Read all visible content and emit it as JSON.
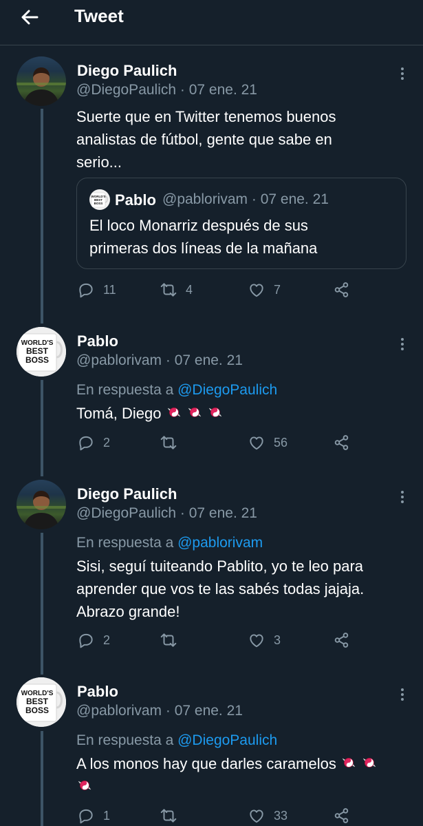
{
  "header": {
    "title": "Tweet",
    "back_icon": "arrow-left-icon"
  },
  "colors": {
    "background": "#15202b",
    "text": "#ffffff",
    "muted": "#8899a6",
    "link": "#1d9bf0",
    "border": "#38444d"
  },
  "tweets": [
    {
      "name": "Diego Paulich",
      "meta": "@DiegoPaulich · 07 ene. 21",
      "text_lines": [
        "Suerte que en Twitter tenemos buenos",
        "analistas de fútbol, gente que sabe en",
        "serio..."
      ],
      "quote": {
        "name": "Pablo",
        "meta": "@pablorivam · 07 ene. 21",
        "text_lines": [
          "El loco Monarriz después de sus",
          "primeras dos líneas de la mañana"
        ]
      },
      "replies": "11",
      "retweets": "4",
      "likes": "7"
    },
    {
      "name": "Pablo",
      "meta": "@pablorivam · 07 ene. 21",
      "reply_prefix": "En respuesta a",
      "reply_to": "@DiegoPaulich",
      "text_lines": [
        "Tomá, Diego"
      ],
      "candies": 3,
      "replies": "2",
      "retweets": "",
      "likes": "56"
    },
    {
      "name": "Diego Paulich",
      "meta": "@DiegoPaulich · 07 ene. 21",
      "reply_prefix": "En respuesta a",
      "reply_to": "@pablorivam",
      "text_lines": [
        "Sisi, seguí tuiteando Pablito, yo te leo para",
        "aprender que vos te las sabés todas jajaja.",
        "Abrazo grande!"
      ],
      "replies": "2",
      "retweets": "",
      "likes": "3"
    },
    {
      "name": "Pablo",
      "meta": "@pablorivam · 07 ene. 21",
      "reply_prefix": "En respuesta a",
      "reply_to": "@DiegoPaulich",
      "text_lines": [
        "A los monos hay que darles caramelos"
      ],
      "candies": 3,
      "replies": "1",
      "retweets": "",
      "likes": "33"
    }
  ],
  "mug_text": [
    "WORLD'S",
    "BEST",
    "BOSS"
  ]
}
